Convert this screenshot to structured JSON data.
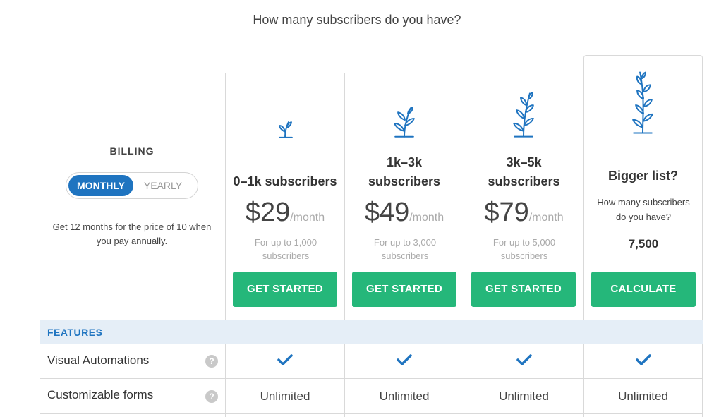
{
  "headline": "How many subscribers do you have?",
  "billing": {
    "title": "BILLING",
    "options": [
      "MONTHLY",
      "YEARLY"
    ],
    "selected": "MONTHLY",
    "note": "Get 12 months for the price of 10 when you pay annually."
  },
  "plans": [
    {
      "name": "0–1k subscribers",
      "price": "$29",
      "period": "/month",
      "limit": "For up to 1,000 subscribers",
      "cta": "GET STARTED",
      "icon": "sprout-icon"
    },
    {
      "name": "1k–3k subscribers",
      "price": "$49",
      "period": "/month",
      "limit": "For up to 3,000 subscribers",
      "cta": "GET STARTED",
      "icon": "plant-icon"
    },
    {
      "name": "3k–5k subscribers",
      "price": "$79",
      "period": "/month",
      "limit": "For up to 5,000 subscribers",
      "cta": "GET STARTED",
      "icon": "tall-plant-icon"
    }
  ],
  "bigger": {
    "title": "Bigger list?",
    "question": "How many subscribers do you have?",
    "value": "7,500",
    "cta": "CALCULATE",
    "icon": "tallest-plant-icon"
  },
  "features": {
    "header": "FEATURES",
    "help_glyph": "?",
    "rows": [
      {
        "name": "Visual Automations",
        "values": [
          "check",
          "check",
          "check",
          "check"
        ]
      },
      {
        "name": "Customizable forms",
        "values": [
          "Unlimited",
          "Unlimited",
          "Unlimited",
          "Unlimited"
        ]
      }
    ]
  },
  "colors": {
    "accent_blue": "#1f74c0",
    "cta_green": "#25b77a",
    "features_bg": "#e5eef7",
    "icon_blue": "#1f74c0"
  }
}
